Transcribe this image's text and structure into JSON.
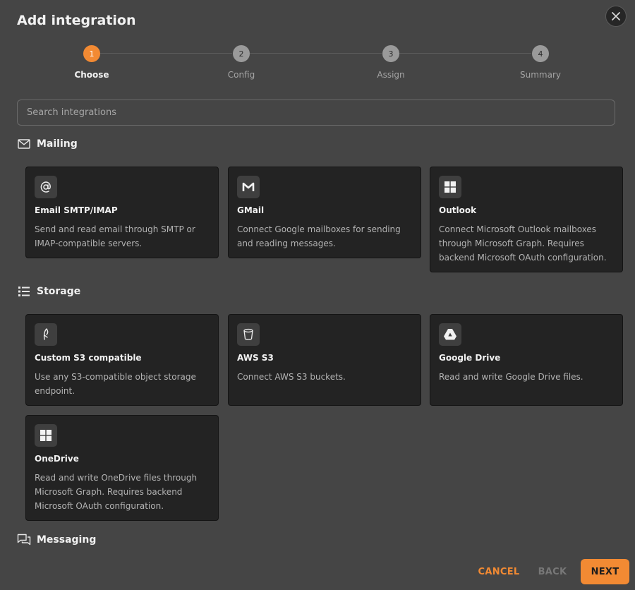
{
  "dialog": {
    "title": "Add integration"
  },
  "steps": [
    {
      "number": "1",
      "label": "Choose",
      "active": true
    },
    {
      "number": "2",
      "label": "Config",
      "active": false
    },
    {
      "number": "3",
      "label": "Assign",
      "active": false
    },
    {
      "number": "4",
      "label": "Summary",
      "active": false
    }
  ],
  "search": {
    "placeholder": "Search integrations",
    "value": ""
  },
  "sections": {
    "mailing": {
      "label": "Mailing",
      "icon": "envelope-icon",
      "cards": [
        {
          "name": "Email SMTP/IMAP",
          "icon": "at-sign-icon",
          "description": "Send and read email through SMTP or IMAP-compatible servers."
        },
        {
          "name": "GMail",
          "icon": "gmail-icon",
          "description": "Connect Google mailboxes for sending and reading messages."
        },
        {
          "name": "Outlook",
          "icon": "windows-icon",
          "description": "Connect Microsoft Outlook mailboxes through Microsoft Graph. Requires backend Microsoft OAuth configuration."
        }
      ]
    },
    "storage": {
      "label": "Storage",
      "icon": "storage-list-icon",
      "cards": [
        {
          "name": "Custom S3 compatible",
          "icon": "feather-icon",
          "description": "Use any S3-compatible object storage endpoint."
        },
        {
          "name": "AWS S3",
          "icon": "bucket-icon",
          "description": "Connect AWS S3 buckets."
        },
        {
          "name": "Google Drive",
          "icon": "google-drive-icon",
          "description": "Read and write Google Drive files."
        },
        {
          "name": "OneDrive",
          "icon": "windows-icon",
          "description": "Read and write OneDrive files through Microsoft Graph. Requires backend Microsoft OAuth configuration."
        }
      ]
    },
    "messaging": {
      "label": "Messaging",
      "icon": "chat-bubbles-icon"
    }
  },
  "footer": {
    "cancel_label": "CANCEL",
    "back_label": "BACK",
    "next_label": "NEXT"
  },
  "colors": {
    "accent": "#f28a33",
    "background": "#454545",
    "card": "#232323"
  }
}
